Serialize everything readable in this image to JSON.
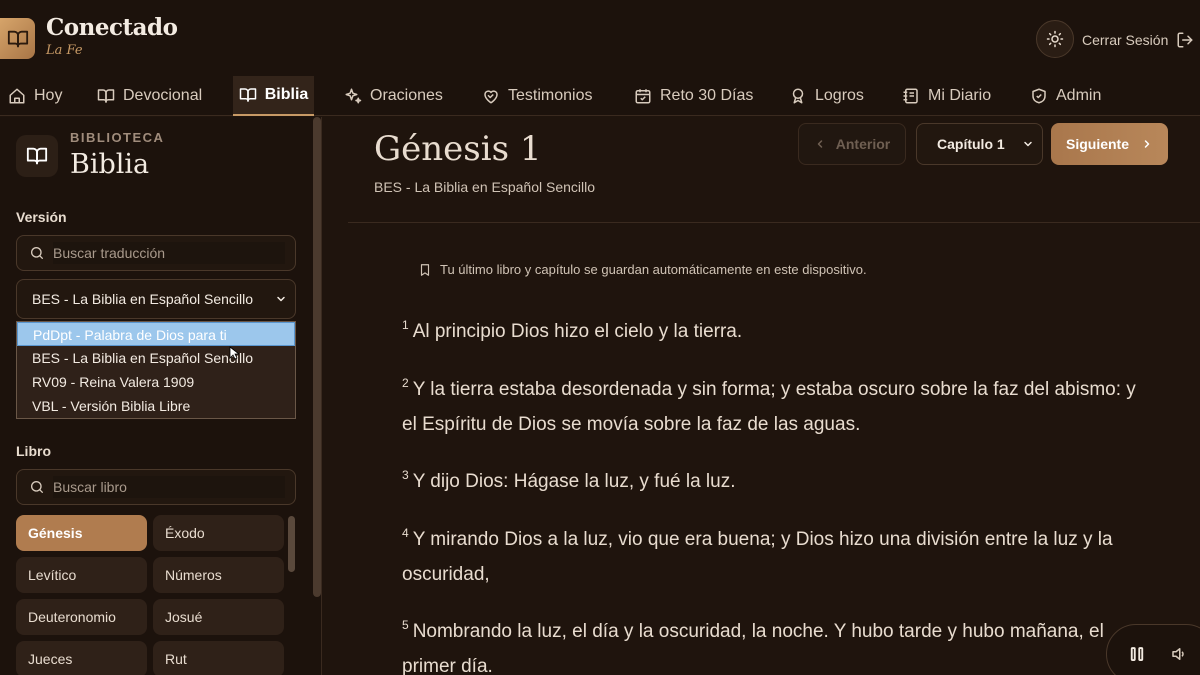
{
  "app": {
    "title": "Conectado",
    "subtitle": "La Fe",
    "logout_label": "Cerrar Sesión"
  },
  "nav": [
    {
      "label": "Hoy",
      "icon": "home-icon"
    },
    {
      "label": "Devocional",
      "icon": "book-open-icon"
    },
    {
      "label": "Biblia",
      "icon": "book-open-icon",
      "active": true
    },
    {
      "label": "Oraciones",
      "icon": "sparkles-icon"
    },
    {
      "label": "Testimonios",
      "icon": "heart-handshake-icon"
    },
    {
      "label": "Reto 30 Días",
      "icon": "calendar-check-icon"
    },
    {
      "label": "Logros",
      "icon": "award-icon"
    },
    {
      "label": "Mi Diario",
      "icon": "notebook-icon"
    },
    {
      "label": "Admin",
      "icon": "shield-check-icon"
    }
  ],
  "sidebar": {
    "kicker": "BIBLIOTECA",
    "title": "Biblia",
    "version_label": "Versión",
    "translation_search_placeholder": "Buscar traducción",
    "selected_version": "BES - La Biblia en Español Sencillo",
    "version_options": [
      "PdDpt - Palabra de Dios para ti",
      "BES - La Biblia en Español Sencillo",
      "RV09 - Reina Valera 1909",
      "VBL - Versión Biblia Libre"
    ],
    "highlighted_option_index": 0,
    "book_label": "Libro",
    "book_search_placeholder": "Buscar libro",
    "books": [
      "Génesis",
      "Éxodo",
      "Levítico",
      "Números",
      "Deuteronomio",
      "Josué",
      "Jueces",
      "Rut"
    ],
    "active_book": "Génesis"
  },
  "main": {
    "chapter_title": "Génesis 1",
    "version_name": "BES - La Biblia en Español Sencillo",
    "prev_label": "Anterior",
    "chapter_select": "Capítulo 1",
    "next_label": "Siguiente",
    "note": "Tu último libro y capítulo se guardan automáticamente en este dispositivo.",
    "verses": [
      {
        "num": "1",
        "text": "Al principio Dios hizo el cielo y la tierra."
      },
      {
        "num": "2",
        "text": "Y la tierra estaba desordenada y sin forma; y estaba oscuro sobre la faz del abismo: y el Espíritu de Dios se movía sobre la faz de las aguas."
      },
      {
        "num": "3",
        "text": "Y dijo Dios: Hágase la luz, y fué la luz."
      },
      {
        "num": "4",
        "text": "Y mirando Dios a la luz, vio que era buena; y Dios hizo una división entre la luz y la oscuridad,"
      },
      {
        "num": "5",
        "text": "Nombrando la luz, el día y la oscuridad, la noche. Y hubo tarde y hubo mañana, el primer día."
      }
    ]
  },
  "colors": {
    "background": "#1f140d",
    "accent": "#b07c4f",
    "text": "#e8dccf"
  }
}
